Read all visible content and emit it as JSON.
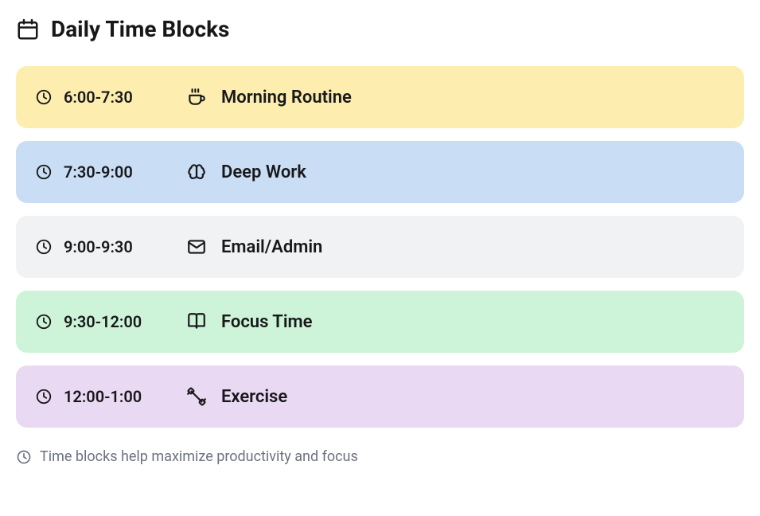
{
  "header": {
    "title": "Daily Time Blocks"
  },
  "blocks": [
    {
      "time": "6:00-7:30",
      "activity": "Morning Routine",
      "icon": "coffee",
      "color": "yellow"
    },
    {
      "time": "7:30-9:00",
      "activity": "Deep Work",
      "icon": "brain",
      "color": "blue"
    },
    {
      "time": "9:00-9:30",
      "activity": "Email/Admin",
      "icon": "mail",
      "color": "gray"
    },
    {
      "time": "9:30-12:00",
      "activity": "Focus Time",
      "icon": "book",
      "color": "green"
    },
    {
      "time": "12:00-1:00",
      "activity": "Exercise",
      "icon": "dumbbell",
      "color": "purple"
    }
  ],
  "footer": {
    "text": "Time blocks help maximize productivity and focus"
  }
}
